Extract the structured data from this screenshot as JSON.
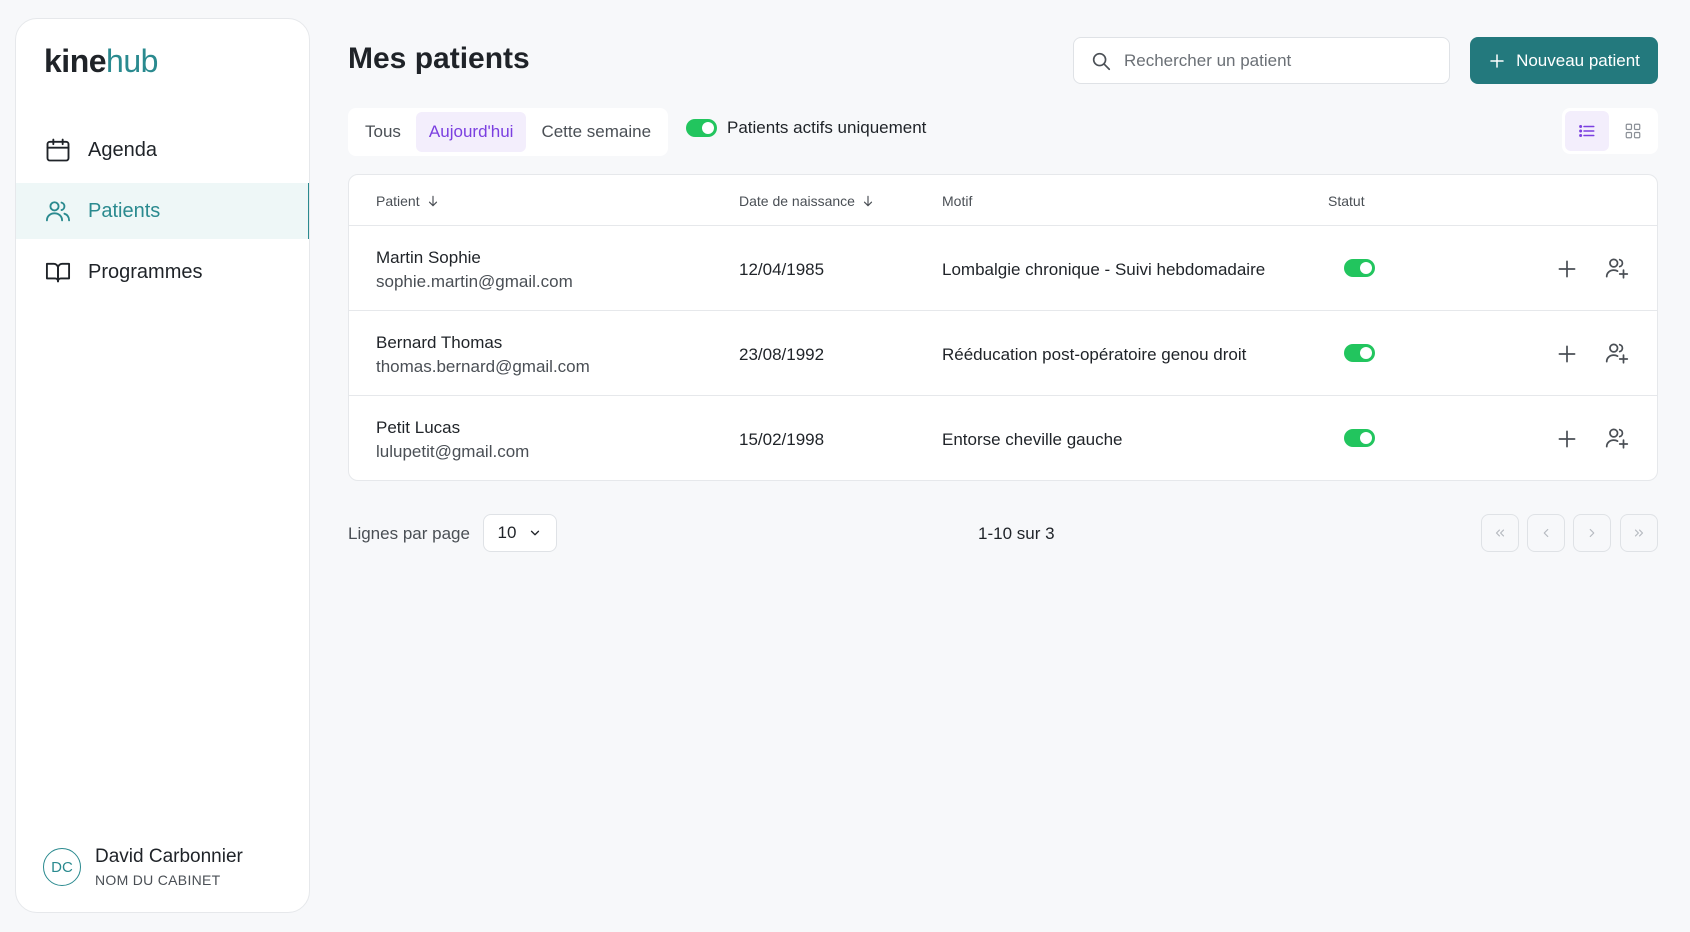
{
  "brand": {
    "part1": "kine",
    "part2": "hub",
    "accent": "#2a8a8f"
  },
  "sidebar": {
    "items": [
      {
        "label": "Agenda",
        "icon": "calendar-icon"
      },
      {
        "label": "Patients",
        "icon": "users-icon",
        "active": true
      },
      {
        "label": "Programmes",
        "icon": "book-icon"
      }
    ],
    "user": {
      "initials": "DC",
      "name": "David Carbonnier",
      "subtitle": "NOM DU CABINET"
    }
  },
  "header": {
    "title": "Mes patients",
    "search_placeholder": "Rechercher un patient",
    "new_button": "Nouveau patient"
  },
  "filters": {
    "tabs": [
      "Tous",
      "Aujourd'hui",
      "Cette semaine"
    ],
    "active_tab": "Aujourd'hui",
    "active_only_label": "Patients actifs uniquement",
    "active_only": true
  },
  "table": {
    "headers": {
      "patient": "Patient",
      "dob": "Date de naissance",
      "motif": "Motif",
      "status": "Statut"
    },
    "rows": [
      {
        "name": "Martin Sophie",
        "email": "sophie.martin@gmail.com",
        "dob": "12/04/1985",
        "motif": "Lombalgie chronique - Suivi hebdomadaire",
        "active": true
      },
      {
        "name": "Bernard Thomas",
        "email": "thomas.bernard@gmail.com",
        "dob": "23/08/1992",
        "motif": "Rééducation post-opératoire genou droit",
        "active": true
      },
      {
        "name": "Petit Lucas",
        "email": "lulupetit@gmail.com",
        "dob": "15/02/1998",
        "motif": "Entorse cheville gauche",
        "active": true
      }
    ]
  },
  "pagination": {
    "rows_label": "Lignes par page",
    "rows_value": "10",
    "range": "1-10 sur 3"
  },
  "colors": {
    "primary": "#23797d",
    "tab_active": "#7b3fe0",
    "toggle_on": "#22c55e"
  }
}
